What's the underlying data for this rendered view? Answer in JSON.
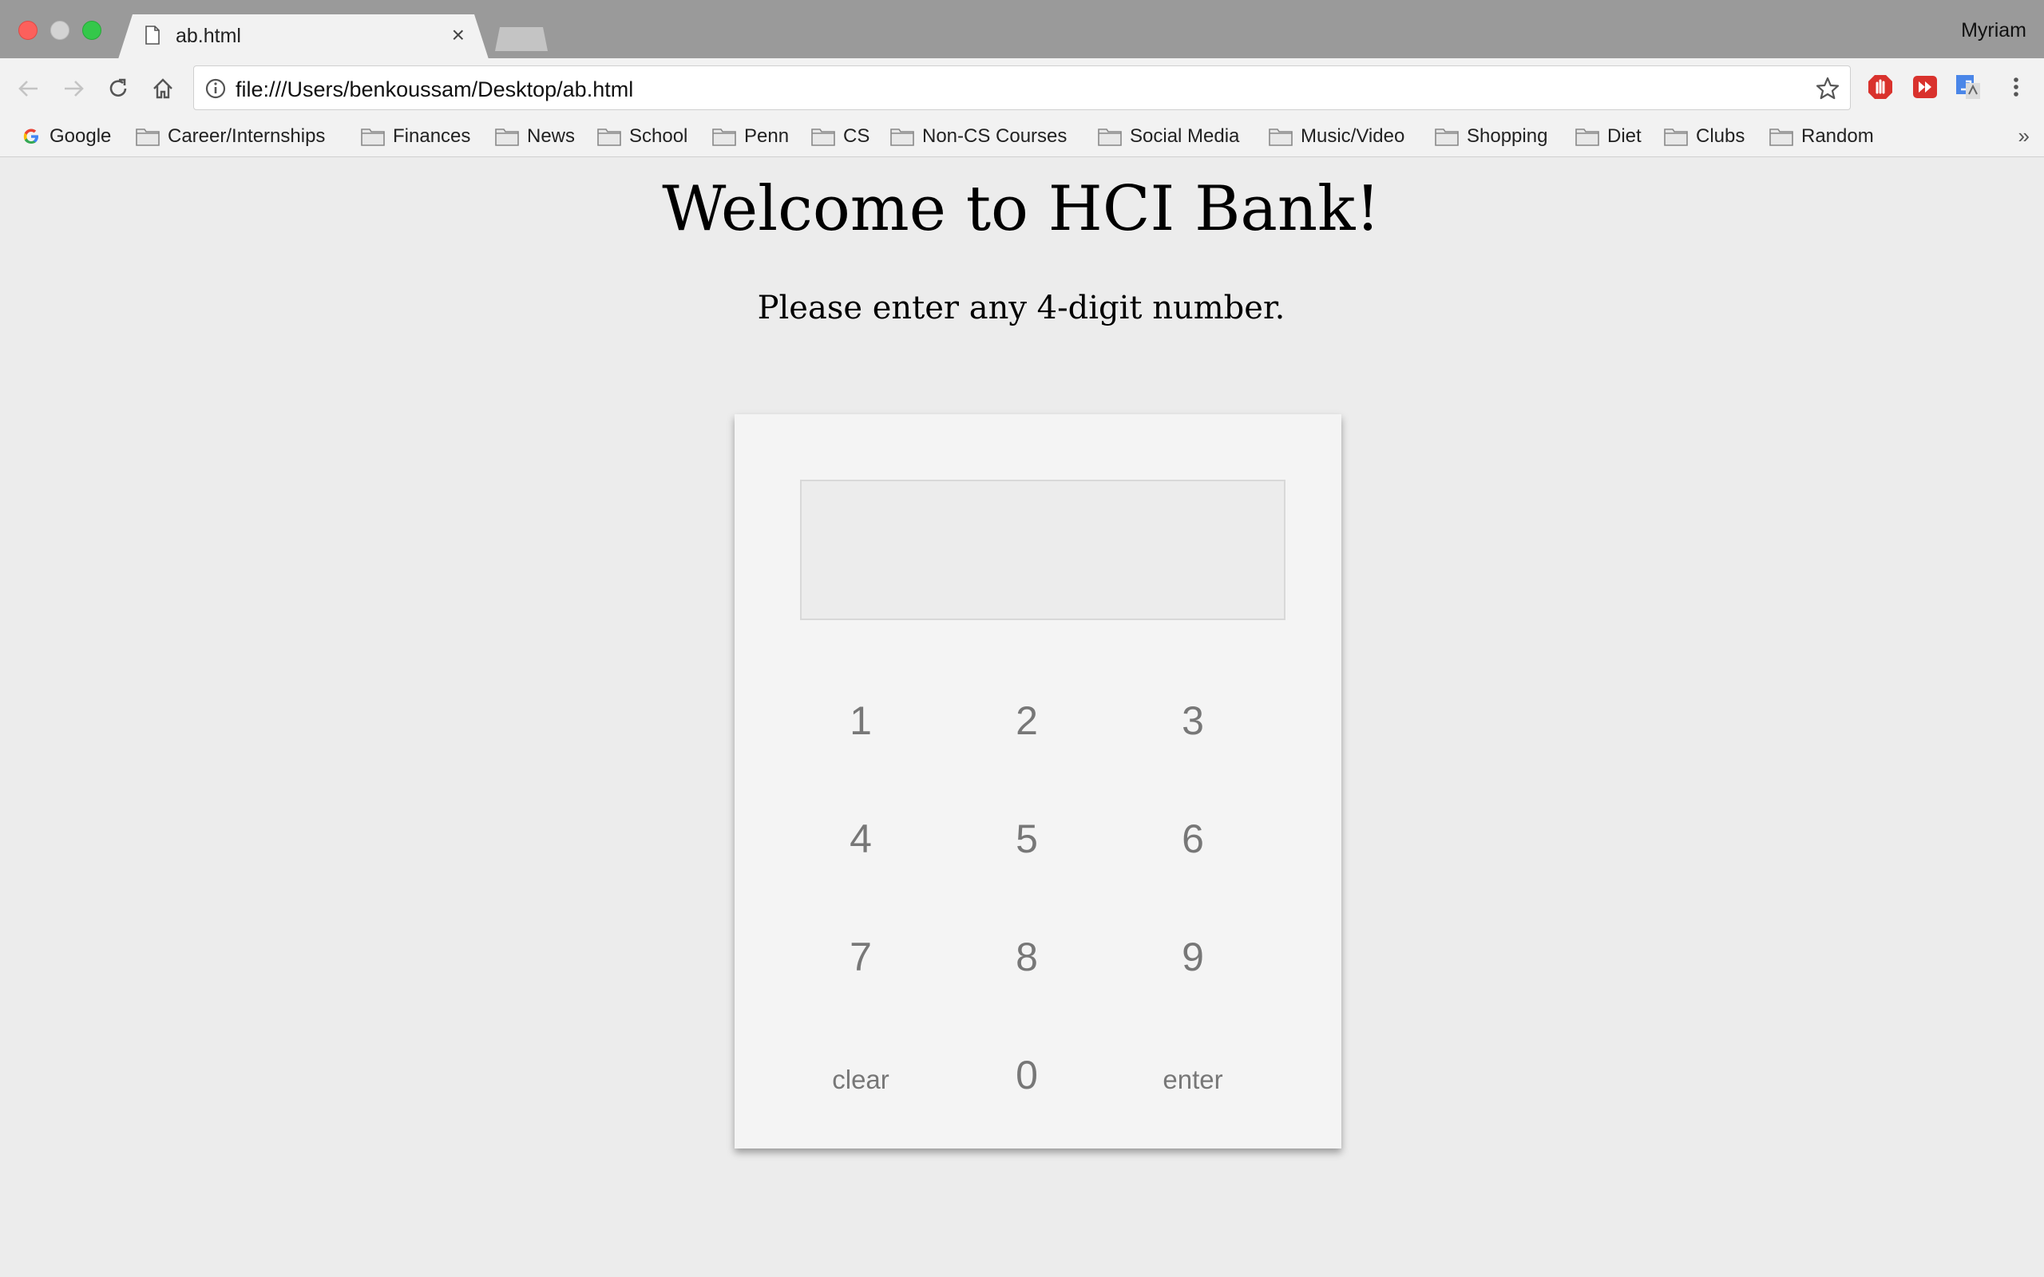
{
  "browser": {
    "tab_title": "ab.html",
    "tab_close": "×",
    "profile_name": "Myriam",
    "url": "file:///Users/benkoussam/Desktop/ab.html",
    "bookmarks": [
      "Google",
      "Career/Internships",
      "Finances",
      "News",
      "School",
      "Penn",
      "CS",
      "Non-CS Courses",
      "Social Media",
      "Music/Video",
      "Shopping",
      "Diet",
      "Clubs",
      "Random"
    ],
    "bookmarks_more": "»"
  },
  "page": {
    "title": "Welcome to HCI Bank!",
    "subtitle": "Please enter any 4-digit number.",
    "display_value": "",
    "keys": {
      "k1": "1",
      "k2": "2",
      "k3": "3",
      "k4": "4",
      "k5": "5",
      "k6": "6",
      "k7": "7",
      "k8": "8",
      "k9": "9",
      "clear": "clear",
      "k0": "0",
      "enter": "enter"
    }
  },
  "colors": {
    "titlebar": "#9a9a9a",
    "page_background": "#ececec",
    "keypad_background": "#f4f4f4",
    "key_text": "#777777"
  }
}
